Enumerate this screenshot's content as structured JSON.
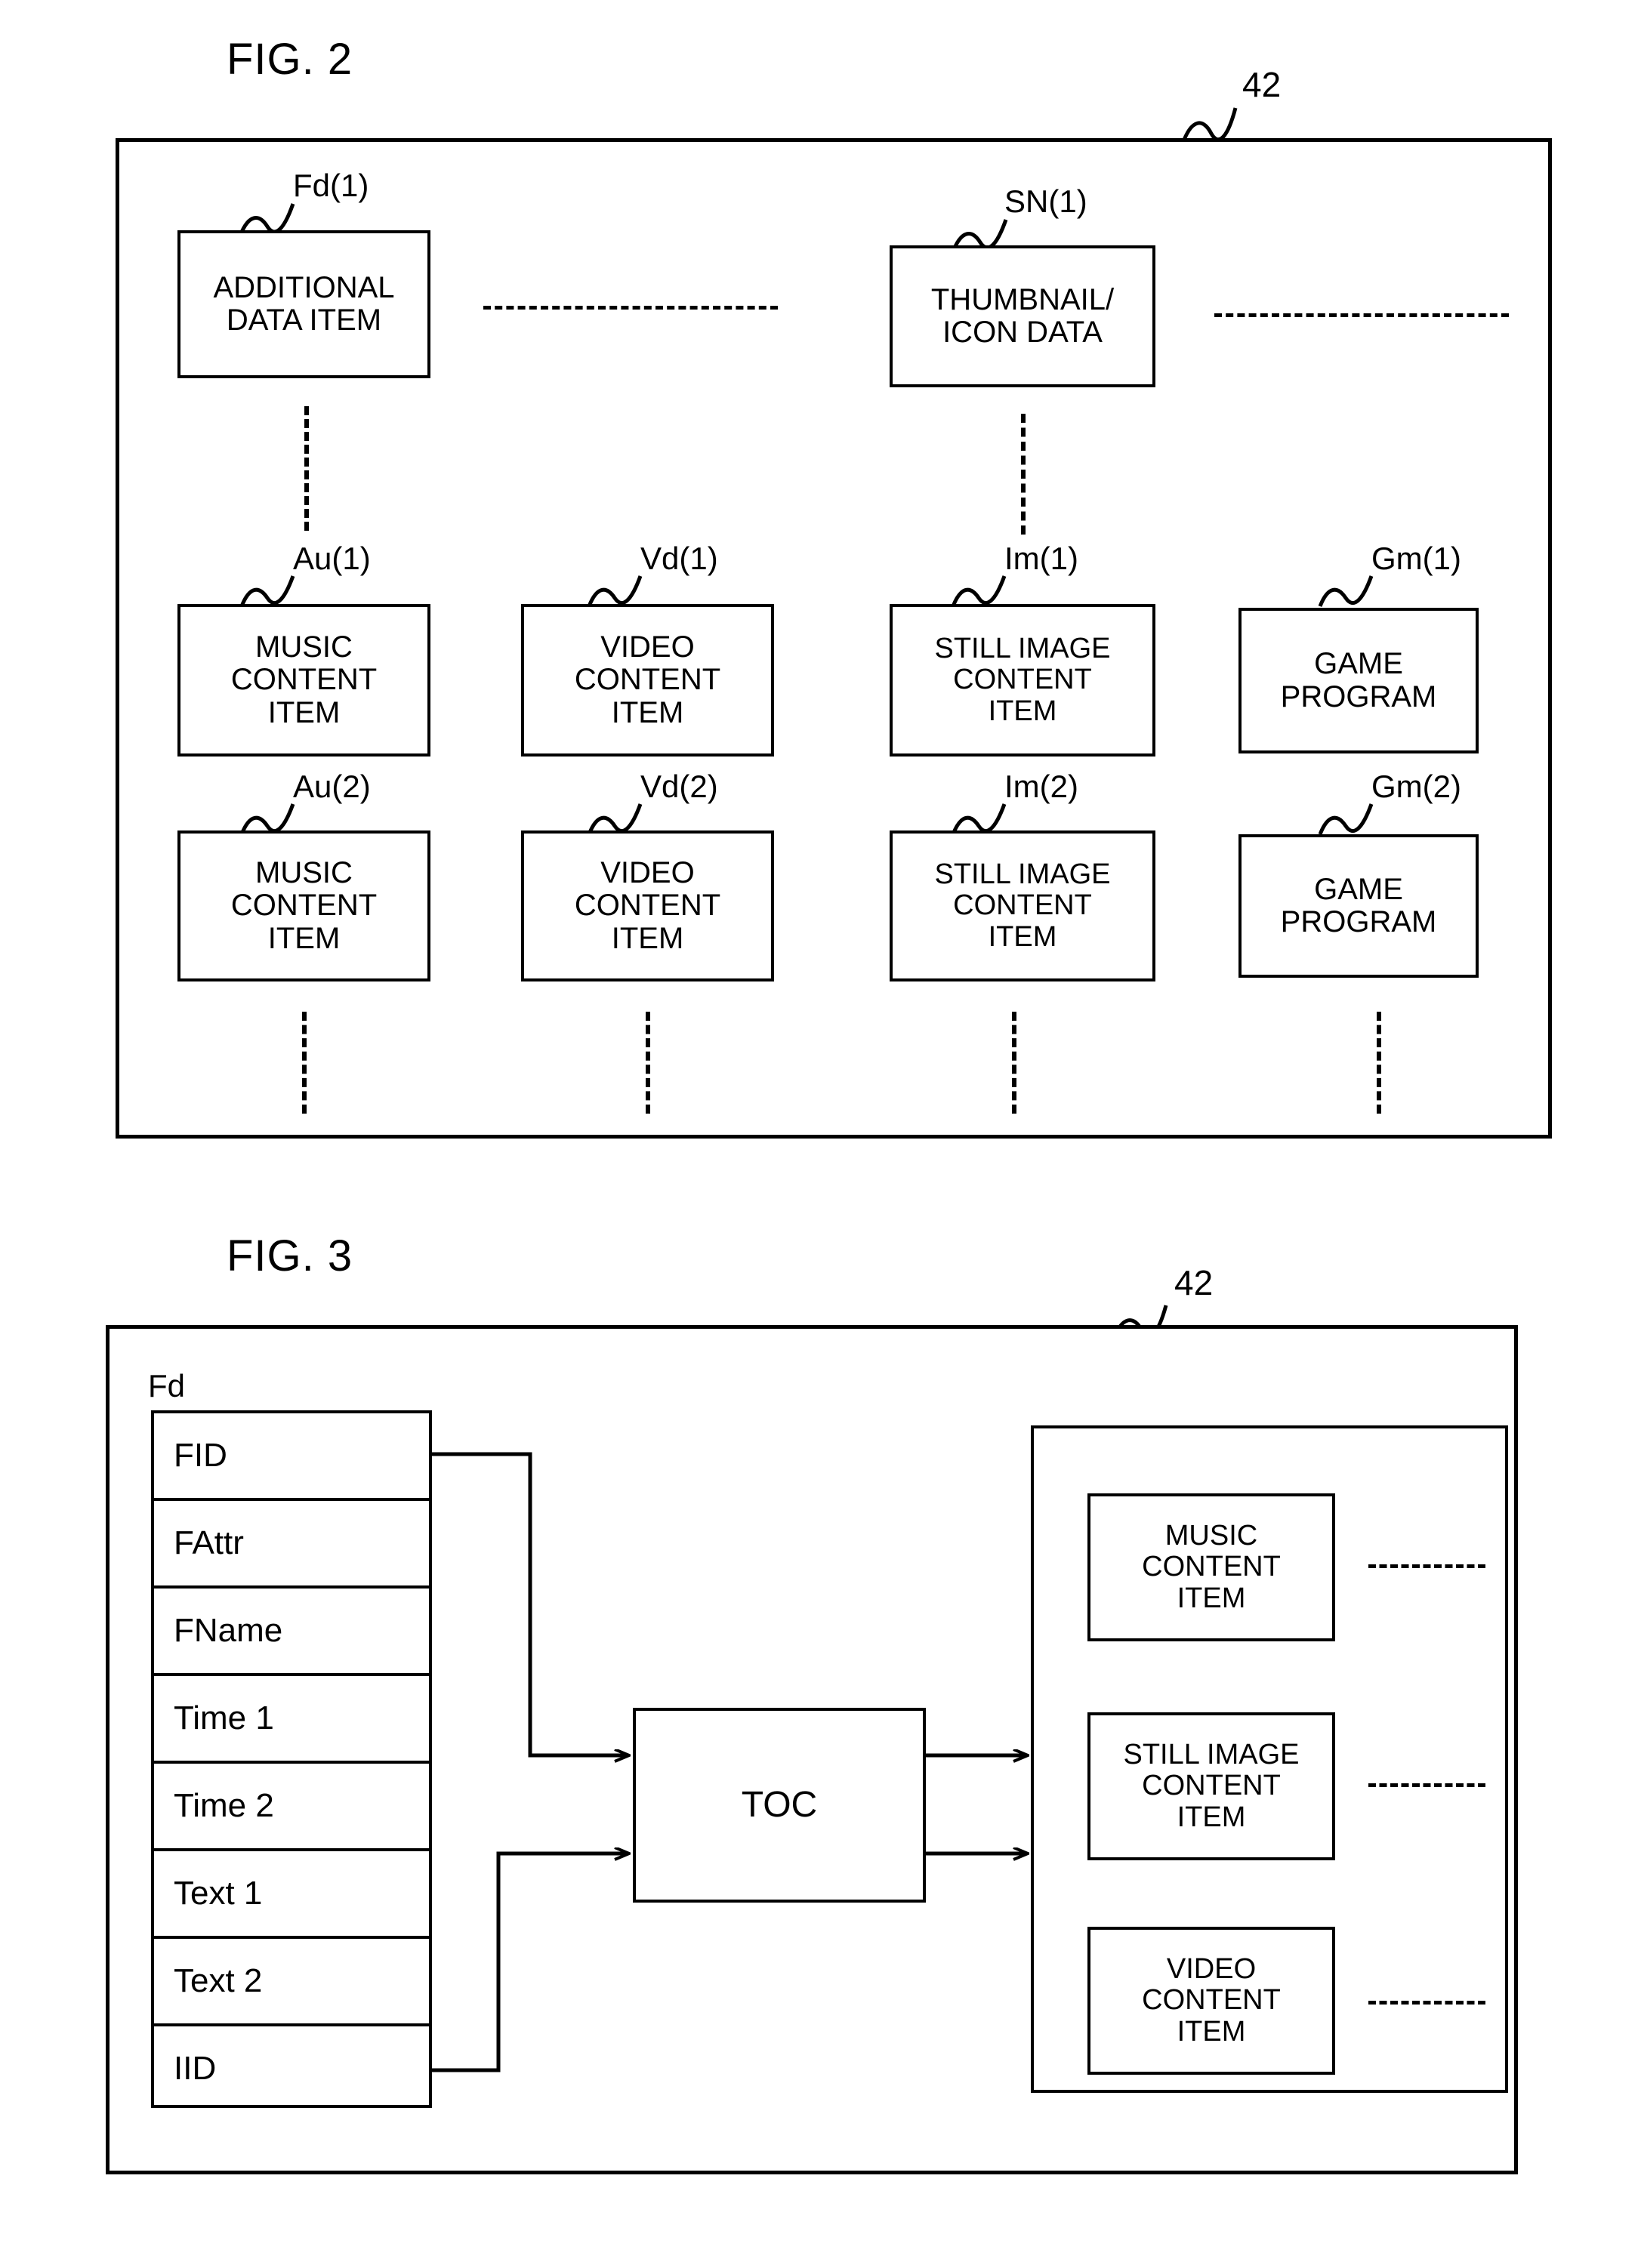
{
  "figures": [
    {
      "caption": "FIG. 2",
      "frame_ref": "42",
      "top_row": [
        {
          "ref": "Fd(1)",
          "lines": [
            "ADDITIONAL",
            "DATA ITEM"
          ]
        },
        {
          "ref": "SN(1)",
          "lines": [
            "THUMBNAIL/",
            "ICON DATA"
          ]
        }
      ],
      "content_rows": [
        [
          {
            "ref": "Au(1)",
            "lines": [
              "MUSIC",
              "CONTENT",
              "ITEM"
            ]
          },
          {
            "ref": "Vd(1)",
            "lines": [
              "VIDEO",
              "CONTENT",
              "ITEM"
            ]
          },
          {
            "ref": "Im(1)",
            "lines": [
              "STILL IMAGE",
              "CONTENT",
              "ITEM"
            ]
          },
          {
            "ref": "Gm(1)",
            "lines": [
              "GAME",
              "PROGRAM"
            ]
          }
        ],
        [
          {
            "ref": "Au(2)",
            "lines": [
              "MUSIC",
              "CONTENT",
              "ITEM"
            ]
          },
          {
            "ref": "Vd(2)",
            "lines": [
              "VIDEO",
              "CONTENT",
              "ITEM"
            ]
          },
          {
            "ref": "Im(2)",
            "lines": [
              "STILL IMAGE",
              "CONTENT",
              "ITEM"
            ]
          },
          {
            "ref": "Gm(2)",
            "lines": [
              "GAME",
              "PROGRAM"
            ]
          }
        ]
      ]
    },
    {
      "caption": "FIG. 3",
      "frame_ref": "42",
      "table_label": "Fd",
      "table_rows": [
        "FID",
        "FAttr",
        "FName",
        "Time 1",
        "Time 2",
        "Text 1",
        "Text 2",
        "IID"
      ],
      "toc_label": "TOC",
      "content_boxes": [
        {
          "lines": [
            "MUSIC",
            "CONTENT",
            "ITEM"
          ]
        },
        {
          "lines": [
            "STILL IMAGE",
            "CONTENT",
            "ITEM"
          ]
        },
        {
          "lines": [
            "VIDEO",
            "CONTENT",
            "ITEM"
          ]
        }
      ]
    }
  ],
  "fig2": {
    "caption": "FIG. 2",
    "ref_42": "42",
    "box_fd1_l1": "ADDITIONAL",
    "box_fd1_l2": "DATA ITEM",
    "ref_fd1": "Fd(1)",
    "box_sn1_l1": "THUMBNAIL/",
    "box_sn1_l2": "ICON DATA",
    "ref_sn1": "SN(1)",
    "ref_au1": "Au(1)",
    "ref_vd1": "Vd(1)",
    "ref_im1": "Im(1)",
    "ref_gm1": "Gm(1)",
    "ref_au2": "Au(2)",
    "ref_vd2": "Vd(2)",
    "ref_im2": "Im(2)",
    "ref_gm2": "Gm(2)",
    "music_l1": "MUSIC",
    "music_l2": "CONTENT",
    "music_l3": "ITEM",
    "video_l1": "VIDEO",
    "video_l2": "CONTENT",
    "video_l3": "ITEM",
    "still_l1": "STILL IMAGE",
    "still_l2": "CONTENT",
    "still_l3": "ITEM",
    "game_l1": "GAME",
    "game_l2": "PROGRAM"
  },
  "fig3": {
    "caption": "FIG. 3",
    "ref_42": "42",
    "table_label": "Fd",
    "row_fid": "FID",
    "row_fattr": "FAttr",
    "row_fname": "FName",
    "row_time1": "Time 1",
    "row_time2": "Time 2",
    "row_text1": "Text 1",
    "row_text2": "Text 2",
    "row_iid": "IID",
    "toc": "TOC",
    "music_l1": "MUSIC",
    "music_l2": "CONTENT",
    "music_l3": "ITEM",
    "still_l1": "STILL IMAGE",
    "still_l2": "CONTENT",
    "still_l3": "ITEM",
    "video_l1": "VIDEO",
    "video_l2": "CONTENT",
    "video_l3": "ITEM"
  },
  "colors": {
    "ink": "#000000",
    "paper": "#ffffff"
  }
}
